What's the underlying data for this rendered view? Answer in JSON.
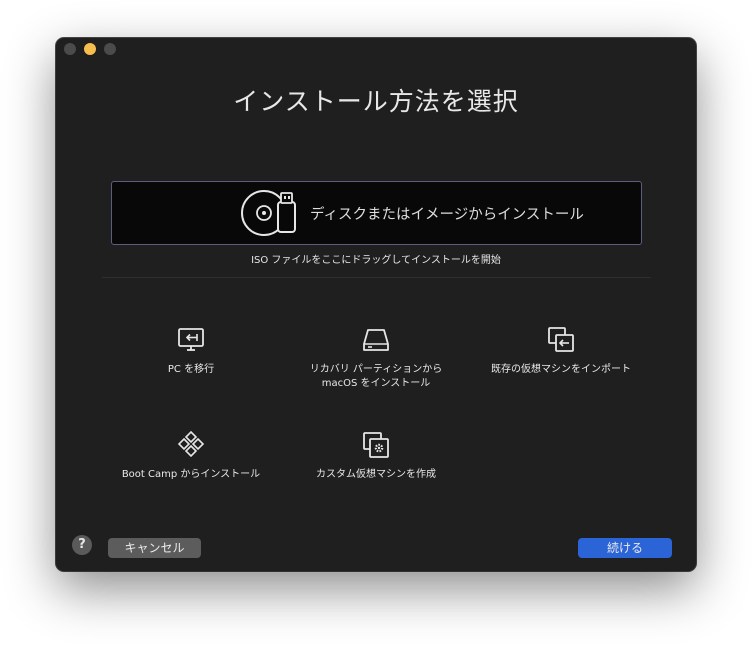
{
  "window": {
    "title": "インストール方法を選択"
  },
  "drop_zone": {
    "label": "ディスクまたはイメージからインストール",
    "hint": "ISO ファイルをここにドラッグしてインストールを開始",
    "icon": "disc-usb-icon"
  },
  "options": [
    {
      "label": "PC を移行",
      "icon": "monitor-arrow-icon"
    },
    {
      "label": "リカバリ パーティションから\nmacOS をインストール",
      "icon": "drive-icon"
    },
    {
      "label": "既存の仮想マシンをインポート",
      "icon": "import-windows-icon"
    },
    {
      "label": "Boot Camp からインストール",
      "icon": "bootcamp-diamonds-icon"
    },
    {
      "label": "カスタム仮想マシンを作成",
      "icon": "gear-window-icon"
    }
  ],
  "footer": {
    "help_label": "?",
    "cancel_label": "キャンセル",
    "continue_label": "続ける"
  },
  "colors": {
    "window_bg": "#1f1f1f",
    "accent": "#2a64d6",
    "minimize": "#f5be4f"
  }
}
